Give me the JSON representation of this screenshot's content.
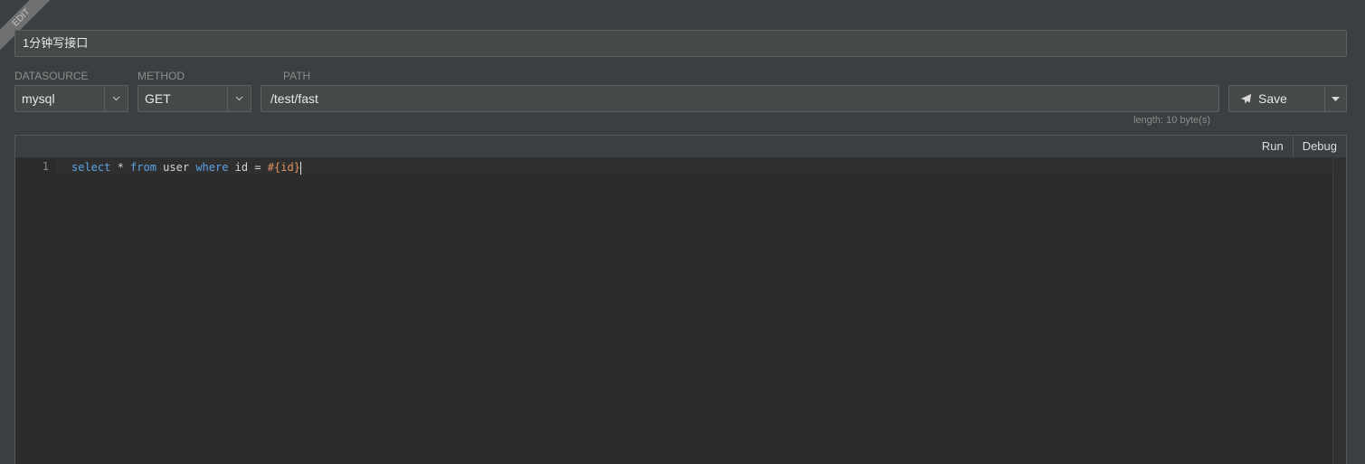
{
  "ribbon": "EDIT",
  "title": {
    "value": "1分钟写接口"
  },
  "datasource": {
    "label": "DATASOURCE",
    "value": "mysql"
  },
  "method": {
    "label": "METHOD",
    "value": "GET"
  },
  "path": {
    "label": "PATH",
    "value": "/test/fast",
    "length_hint": "length: 10 byte(s)"
  },
  "save": {
    "label": "Save"
  },
  "editor": {
    "run_label": "Run",
    "debug_label": "Debug",
    "line_number": "1",
    "tokens": {
      "select": "select",
      "star": " * ",
      "from": "from",
      "user": " user ",
      "where": "where",
      "cond": " id = ",
      "param": "#{id}"
    }
  },
  "colors": {
    "keyword": "#5ba3e6",
    "param": "#e09060",
    "background": "#3c3f41",
    "editor_bg": "#2b2b2b"
  }
}
